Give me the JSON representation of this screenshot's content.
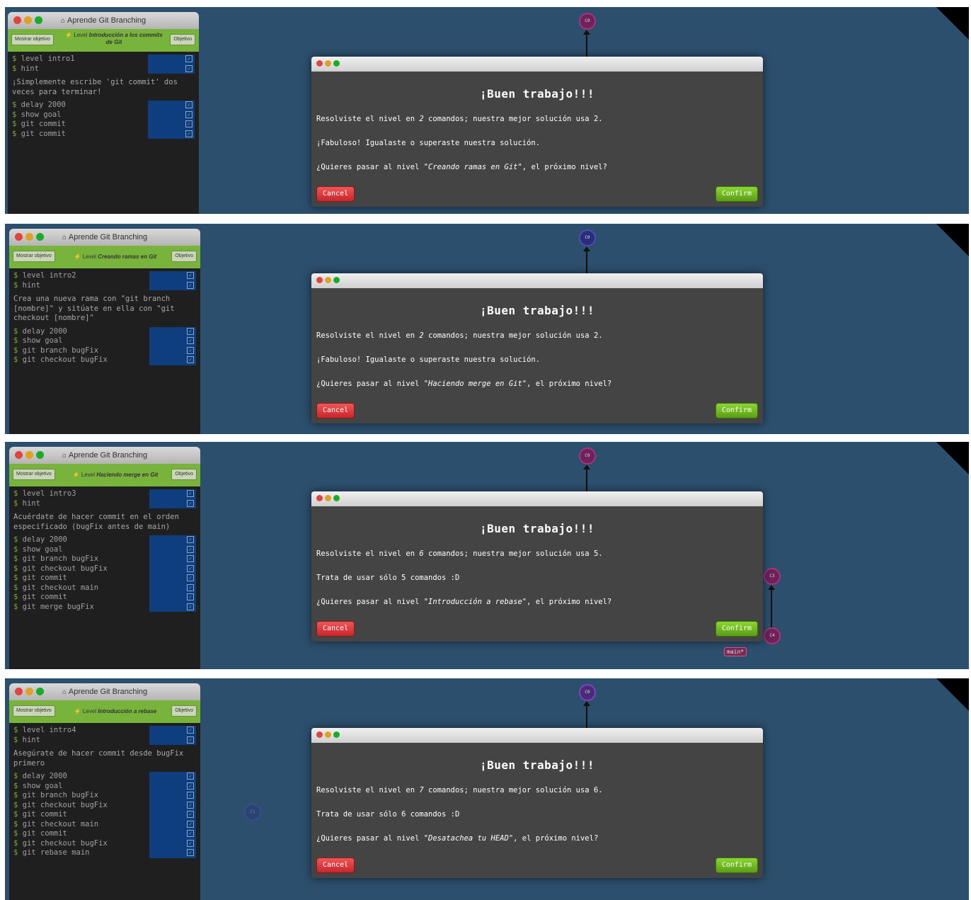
{
  "app_title": "Aprende Git Branching",
  "show_goal_label": "Mostrar objetivo",
  "objective_label": "Objetivo",
  "level_prefix": "Level",
  "modal_title": "¡Buen trabajo!!!",
  "cancel_label": "Cancel",
  "confirm_label": "Confirm",
  "panels": [
    {
      "level_name": "Introducción a los commits de Git",
      "pre_commands": [
        "level intro1",
        "hint"
      ],
      "message": "¡Simplemente escribe 'git commit' dos veces para terminar!",
      "commands": [
        "delay 2000",
        "show goal",
        "git commit",
        "git commit"
      ],
      "modal": {
        "solved_a": "Resolviste el nivel en ",
        "solved_n": "2",
        "solved_b": " comandos; nuestra mejor solución usa 2.",
        "feedback": "¡Fabuloso! Igualaste o superaste nuestra solución.",
        "next_a": "¿Quieres pasar al nivel ",
        "next_level": "\"Creando ramas en Git\"",
        "next_b": ", el próximo nivel?"
      }
    },
    {
      "level_name": "Creando ramas en Git",
      "pre_commands": [
        "level intro2",
        "hint"
      ],
      "message": "Crea una nueva rama con \"git branch [nombre]\" y sitúate en ella con \"git checkout [nombre]\"",
      "commands": [
        "delay 2000",
        "show goal",
        "git branch bugFix",
        "git checkout bugFix"
      ],
      "modal": {
        "solved_a": "Resolviste el nivel en ",
        "solved_n": "2",
        "solved_b": " comandos; nuestra mejor solución usa 2.",
        "feedback": "¡Fabuloso! Igualaste o superaste nuestra solución.",
        "next_a": "¿Quieres pasar al nivel ",
        "next_level": "\"Haciendo merge en Git\"",
        "next_b": ", el próximo nivel?"
      }
    },
    {
      "level_name": "Haciendo merge en Git",
      "pre_commands": [
        "level intro3",
        "hint"
      ],
      "message": "Acuérdate de hacer commit en el orden especificado (bugFix antes de main)",
      "commands": [
        "delay 2000",
        "show goal",
        "git branch bugFix",
        "git checkout bugFix",
        "git commit",
        "git checkout main",
        "git commit",
        "git merge bugFix"
      ],
      "modal": {
        "solved_a": "Resolviste el nivel en ",
        "solved_n": "6",
        "solved_b": " comandos; nuestra mejor solución usa 5.",
        "feedback": "Trata de usar sólo 5 comandos :D",
        "next_a": "¿Quieres pasar al nivel ",
        "next_level": "\"Introducción a rebase\"",
        "next_b": ", el próximo nivel?"
      }
    },
    {
      "level_name": "Introducción a rebase",
      "pre_commands": [
        "level intro4",
        "hint"
      ],
      "message": "Asegúrate de hacer commit desde bugFix primero",
      "commands": [
        "delay 2000",
        "show goal",
        "git branch bugFix",
        "git checkout bugFix",
        "git commit",
        "git checkout main",
        "git commit",
        "git checkout bugFix",
        "git rebase main"
      ],
      "modal": {
        "solved_a": "Resolviste el nivel en ",
        "solved_n": "7",
        "solved_b": " comandos; nuestra mejor solución usa 6.",
        "feedback": "Trata de usar sólo 6 comandos :D",
        "next_a": "¿Quieres pasar al nivel ",
        "next_level": "\"Desatachea tu HEAD\"",
        "next_b": ", el próximo nivel?"
      }
    }
  ],
  "graph": {
    "c0": "C0",
    "c1": "C1",
    "c3": "C3",
    "c4": "C4",
    "main_label": "main*"
  }
}
